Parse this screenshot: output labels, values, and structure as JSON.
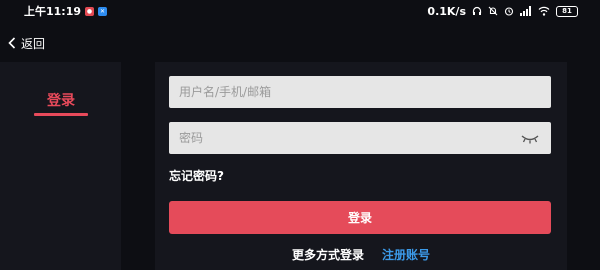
{
  "status_bar": {
    "time": "上午11:19",
    "network_speed": "0.1K/s",
    "battery": "81"
  },
  "nav": {
    "back_label": "返回"
  },
  "sidebar": {
    "login_tab": "登录"
  },
  "form": {
    "username_placeholder": "用户名/手机/邮箱",
    "password_placeholder": "密码",
    "forgot_password": "忘记密码?",
    "login_button": "登录",
    "more_login": "更多方式登录",
    "register": "注册账号"
  },
  "colors": {
    "accent": "#e54b5a",
    "link": "#3c9bea",
    "background": "#0d0e13",
    "panel": "#15161d"
  }
}
